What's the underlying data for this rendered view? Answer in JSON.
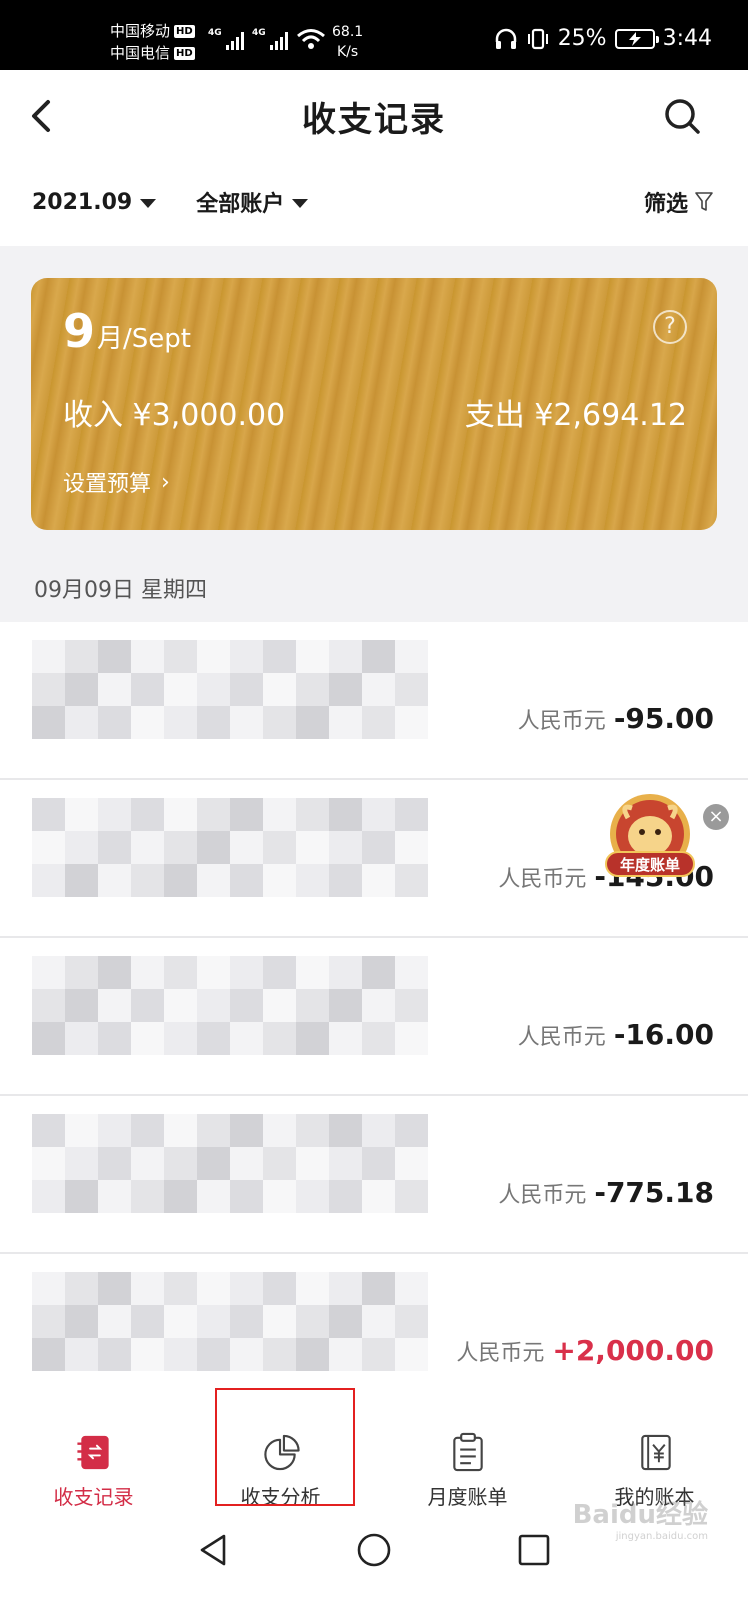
{
  "status_bar": {
    "carrier_1": "中国移动",
    "carrier_2": "中国电信",
    "hd_badge": "HD",
    "network_tag": "4G",
    "speed_value": "68.1",
    "speed_unit": "K/s",
    "battery_percent": "25%",
    "time": "3:44",
    "icons": [
      "headphones-icon",
      "vibrate-icon",
      "battery-charging-icon",
      "wifi-icon",
      "signal-icon"
    ]
  },
  "header": {
    "title": "收支记录",
    "back_icon": "chevron-left-icon",
    "search_icon": "search-icon"
  },
  "filters": {
    "month": "2021.09",
    "account": "全部账户",
    "filter_label": "筛选",
    "filter_icon": "funnel-icon"
  },
  "summary_card": {
    "month_number": "9",
    "month_suffix": "月/Sept",
    "help_symbol": "?",
    "income_label": "收入",
    "income_value": "¥3,000.00",
    "expense_label": "支出",
    "expense_value": "¥2,694.12",
    "budget_link": "设置预算",
    "budget_chevron": "›"
  },
  "date_header": "09月09日 星期四",
  "transactions": [
    {
      "currency": "人民币元",
      "amount": "-95.00",
      "positive": false
    },
    {
      "currency": "人民币元",
      "amount": "-145.00",
      "positive": false
    },
    {
      "currency": "人民币元",
      "amount": "-16.00",
      "positive": false
    },
    {
      "currency": "人民币元",
      "amount": "-775.18",
      "positive": false
    },
    {
      "currency": "人民币元",
      "amount": "+2,000.00",
      "positive": true
    }
  ],
  "annual_badge": {
    "text": "年度账单",
    "close_symbol": "×"
  },
  "tabs": [
    {
      "label": "收支记录",
      "icon": "ledger-icon",
      "active": true
    },
    {
      "label": "收支分析",
      "icon": "pie-chart-icon",
      "active": false
    },
    {
      "label": "月度账单",
      "icon": "clipboard-icon",
      "active": false
    },
    {
      "label": "我的账本",
      "icon": "yuan-book-icon",
      "active": false
    }
  ],
  "watermark": {
    "brand": "Baidu经验",
    "url": "jingyan.baidu.com"
  },
  "colors": {
    "accent_red": "#d32d47",
    "card_gold": "#cf9b3c",
    "highlight_box": "#e32020"
  }
}
